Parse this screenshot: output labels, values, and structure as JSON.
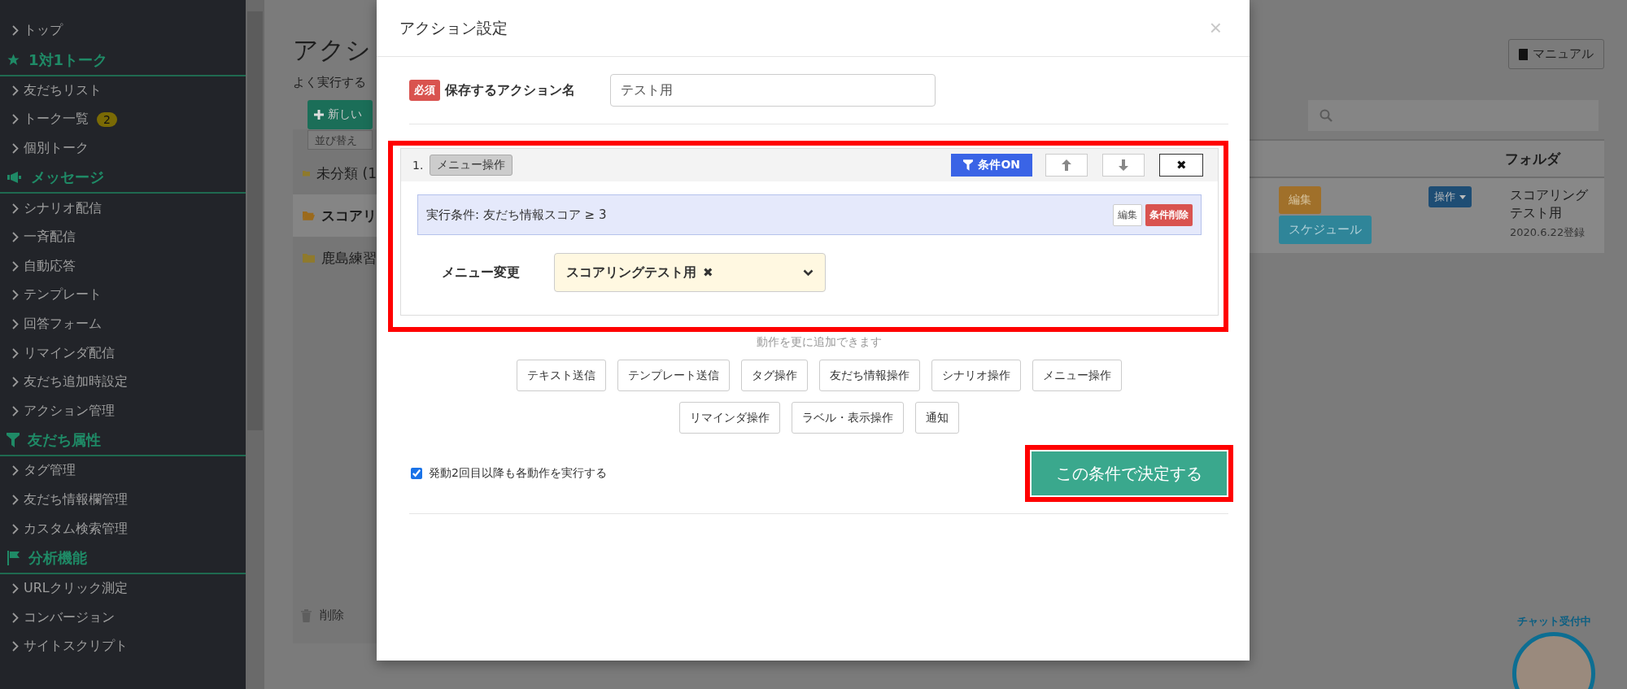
{
  "sidebar": {
    "items": [
      {
        "kind": "link",
        "label": "トップ"
      },
      {
        "kind": "header",
        "label": "1対1トーク"
      },
      {
        "kind": "link",
        "label": "友だちリスト"
      },
      {
        "kind": "link",
        "label": "トーク一覧",
        "badge": "2"
      },
      {
        "kind": "link",
        "label": "個別トーク"
      },
      {
        "kind": "header",
        "label": "メッセージ"
      },
      {
        "kind": "link",
        "label": "シナリオ配信"
      },
      {
        "kind": "link",
        "label": "一斉配信"
      },
      {
        "kind": "link",
        "label": "自動応答"
      },
      {
        "kind": "link",
        "label": "テンプレート"
      },
      {
        "kind": "link",
        "label": "回答フォーム"
      },
      {
        "kind": "link",
        "label": "リマインダ配信"
      },
      {
        "kind": "link",
        "label": "友だち追加時設定"
      },
      {
        "kind": "link",
        "label": "アクション管理"
      },
      {
        "kind": "header",
        "label": "友だち属性"
      },
      {
        "kind": "link",
        "label": "タグ管理"
      },
      {
        "kind": "link",
        "label": "友だち情報欄管理"
      },
      {
        "kind": "link",
        "label": "カスタム検索管理"
      },
      {
        "kind": "header",
        "label": "分析機能"
      },
      {
        "kind": "link",
        "label": "URLクリック測定"
      },
      {
        "kind": "link",
        "label": "コンバージョン"
      },
      {
        "kind": "link",
        "label": "サイトスクリプト"
      }
    ]
  },
  "background_page": {
    "title": "アクシ",
    "subtitle": "よく実行する",
    "manual_button": "マニュアル",
    "new_button": "新しい",
    "sort_menu": "並び替え",
    "folders": [
      {
        "label": "未分類 (1",
        "selected": false
      },
      {
        "label": "スコアリ",
        "selected": true
      },
      {
        "label": "鹿島練習",
        "selected": false
      }
    ],
    "delete_button": "削除",
    "table": {
      "columns": [
        "フォルダ"
      ],
      "row": {
        "edit_button": "編集",
        "schedule_button": "スケジュール",
        "operation_button": "操作",
        "folder": [
          "スコアリング",
          "テスト用"
        ],
        "registered": "2020.6.22登録"
      }
    },
    "chat_widget": {
      "label": "チャット受付中"
    }
  },
  "modal": {
    "title": "アクション設定",
    "close": "×",
    "name_field": {
      "required_badge": "必須",
      "label": "保存するアクション名",
      "value": "テスト用"
    },
    "actions": [
      {
        "number": "1.",
        "type_label": "メニュー操作",
        "highlighted": true,
        "condition_on": true,
        "condition_button": "条件ON",
        "remove": "✖",
        "condition": {
          "text": "実行条件: 友だち情報スコア ≥ 3",
          "edit_button": "編集",
          "delete_button": "条件削除"
        },
        "field_label": "メニュー変更",
        "selected_value": "スコアリングテスト用",
        "value_remove": "✖"
      }
    ],
    "add_hint": "動作を更に追加できます",
    "add_buttons": [
      "テキスト送信",
      "テンプレート送信",
      "タグ操作",
      "友だち情報操作",
      "シナリオ操作",
      "メニュー操作",
      "リマインダ操作",
      "ラベル・表示操作",
      "通知"
    ],
    "repeat_option": {
      "checked": true,
      "label": "発動2回目以降も各動作を実行する"
    },
    "submit": {
      "label": "この条件で決定する",
      "highlighted": true
    }
  }
}
